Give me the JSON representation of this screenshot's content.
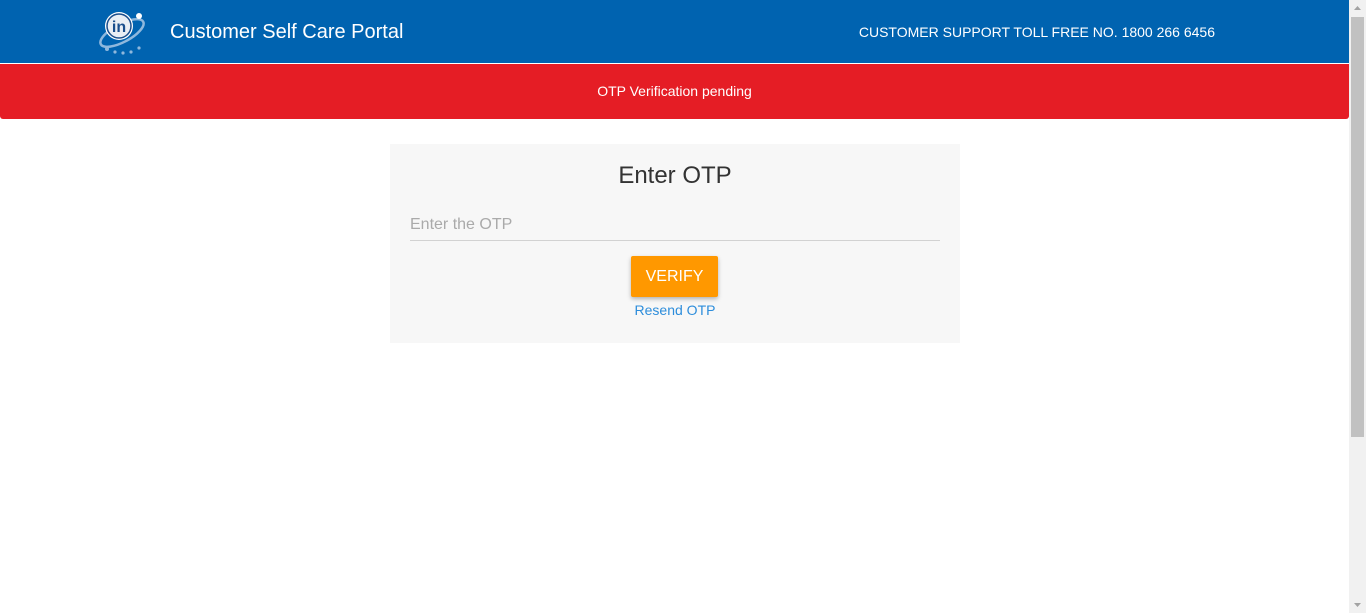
{
  "header": {
    "title": "Customer Self Care Portal",
    "support_text": "CUSTOMER SUPPORT TOLL FREE NO. 1800 266 6456",
    "logo_icon": "in-digital-globe-logo",
    "background_color": "#0063b0"
  },
  "alert": {
    "message": "OTP Verification pending",
    "background_color": "#e51d25"
  },
  "otp_card": {
    "title": "Enter OTP",
    "input": {
      "placeholder": "Enter the OTP",
      "value": ""
    },
    "verify_label": "VERIFY",
    "verify_color": "#ff9800",
    "resend_label": "Resend OTP",
    "resend_color": "#2d8ddb"
  }
}
